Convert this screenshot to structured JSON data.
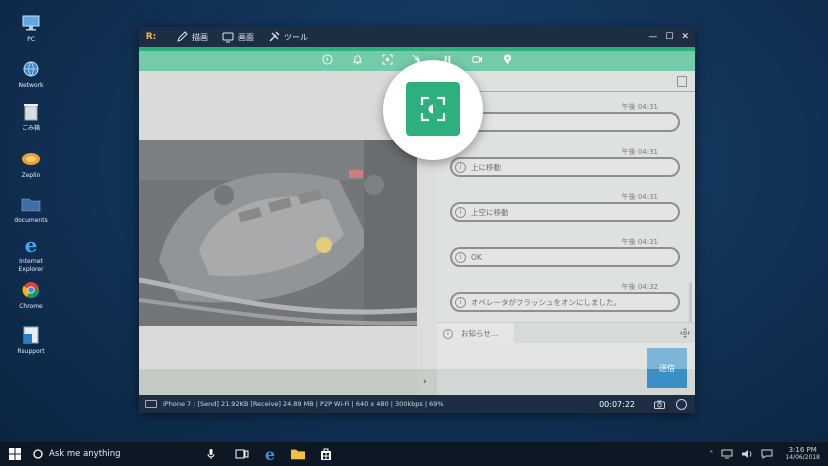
{
  "desktop": {
    "icons": [
      {
        "label": "PC",
        "icon": "computer-icon"
      },
      {
        "label": "Network",
        "icon": "network-icon"
      },
      {
        "label": "ごみ箱",
        "icon": "recycle-bin-icon"
      },
      {
        "label": "Zeplin",
        "icon": "zeplin-icon"
      },
      {
        "label": "documents",
        "icon": "folder-icon"
      },
      {
        "label": "Internet Explorer",
        "icon": "internet-explorer-icon"
      },
      {
        "label": "Chrome",
        "icon": "chrome-icon"
      },
      {
        "label": "Rsupport",
        "icon": "rsupport-icon"
      }
    ]
  },
  "app": {
    "logo": "R:",
    "menu": [
      {
        "label": "描画",
        "icon": "pen-icon"
      },
      {
        "label": "画面",
        "icon": "monitor-icon"
      },
      {
        "label": "ツール",
        "icon": "tools-icon"
      }
    ],
    "window_controls": {
      "minimize": "—",
      "maximize": "☐",
      "close": "✕"
    },
    "toolbar": [
      {
        "icon": "pointer-icon"
      },
      {
        "icon": "bell-icon"
      },
      {
        "icon": "screenshot-icon"
      },
      {
        "icon": "flash-off-icon"
      },
      {
        "icon": "pause-icon"
      },
      {
        "icon": "video-icon"
      },
      {
        "icon": "location-pin-icon"
      }
    ],
    "collapse_arrow": "›",
    "chat": {
      "messages": [
        {
          "time": "午後 04:31",
          "text": ""
        },
        {
          "time": "午後 04:31",
          "text": "上に移動"
        },
        {
          "time": "午後 04:31",
          "text": "上空に移動"
        },
        {
          "time": "午後 04:31",
          "text": "OK"
        },
        {
          "time": "午後 04:32",
          "text": "オペレータがフラッシュをオンにしました。"
        }
      ],
      "info_glyph": "i",
      "tab_label": "お知らせ…",
      "send_label": "送信"
    },
    "status": {
      "text": "iPhone 7 : [Send] 21.92KB  [Receive] 24.89 MB | P2P Wi-Fi | 640 x 480 | 300kbps | 69%",
      "timer": "00:07:22"
    },
    "colors": {
      "accent_green": "#2cb07e",
      "dark_bar": "#1d2e44",
      "send_blue": "#3a8fc5"
    }
  },
  "taskbar": {
    "search_placeholder": "Ask me anything",
    "time": "3:16 PM",
    "date": "14/06/2018"
  }
}
